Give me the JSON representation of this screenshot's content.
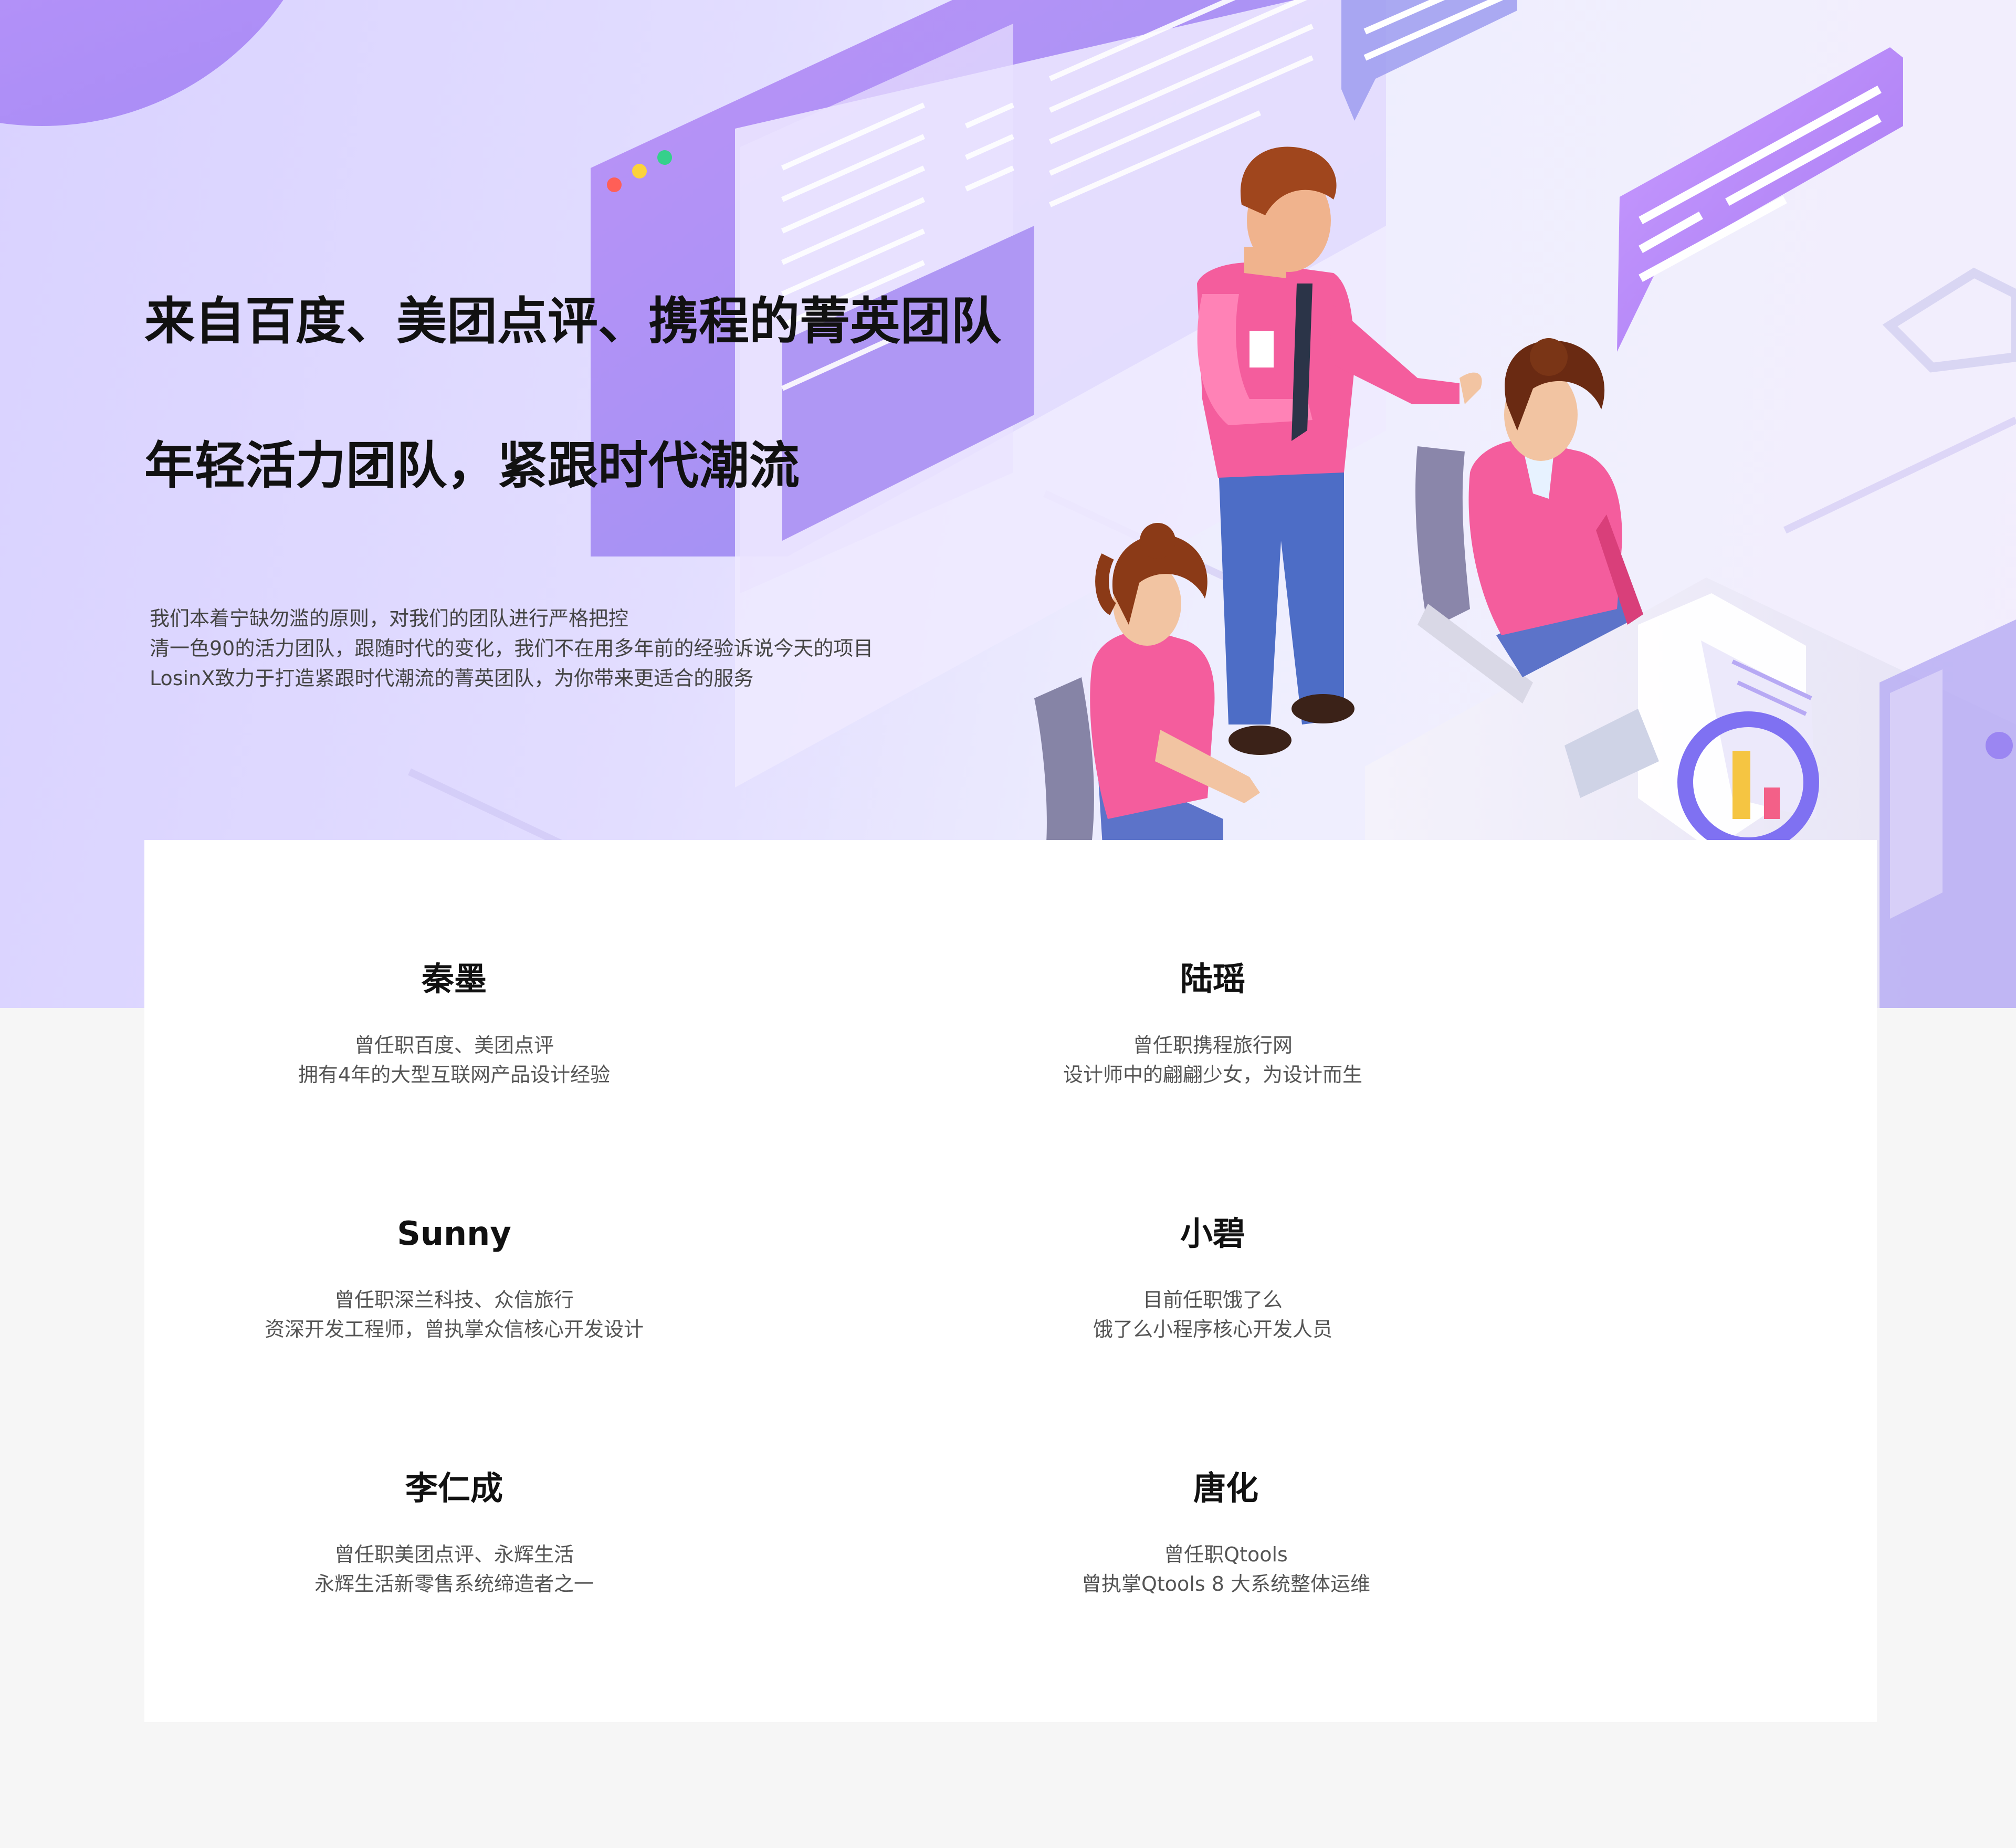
{
  "hero": {
    "title_1": "来自百度、美团点评、携程的菁英团队",
    "title_2": "年轻活力团队，紧跟时代潮流",
    "description": [
      "我们本着宁缺勿滥的原则，对我们的团队进行严格把控",
      "清一色90的活力团队，跟随时代的变化，我们不在用多年前的经验诉说今天的项目",
      "LosinX致力于打造紧跟时代潮流的菁英团队，为你带来更适合的服务"
    ],
    "illustration_icon": "team-office-illustration"
  },
  "team": {
    "members": [
      {
        "name": "秦墨",
        "lines": [
          "曾任职百度、美团点评",
          "拥有4年的大型互联网产品设计经验"
        ]
      },
      {
        "name": "陆瑶",
        "lines": [
          "曾任职携程旅行网",
          "设计师中的翩翩少女，为设计而生"
        ]
      },
      {
        "name": "Sunny",
        "lines": [
          "曾任职深兰科技、众信旅行",
          "资深开发工程师，曾执掌众信核心开发设计"
        ]
      },
      {
        "name": "小碧",
        "lines": [
          "目前任职饿了么",
          "饿了么小程序核心开发人员"
        ]
      },
      {
        "name": "李仁成",
        "lines": [
          "曾任职美团点评、永辉生活",
          "永辉生活新零售系统缔造者之一"
        ]
      },
      {
        "name": "唐化",
        "lines": [
          "曾任职Qtools",
          "曾执掌Qtools 8 大系统整体运维"
        ]
      }
    ]
  },
  "colors": {
    "accent_purple": "#a88cf5",
    "shirt_pink": "#f2559a",
    "page_bg": "#f6f6f6",
    "card_bg": "#ffffff"
  }
}
